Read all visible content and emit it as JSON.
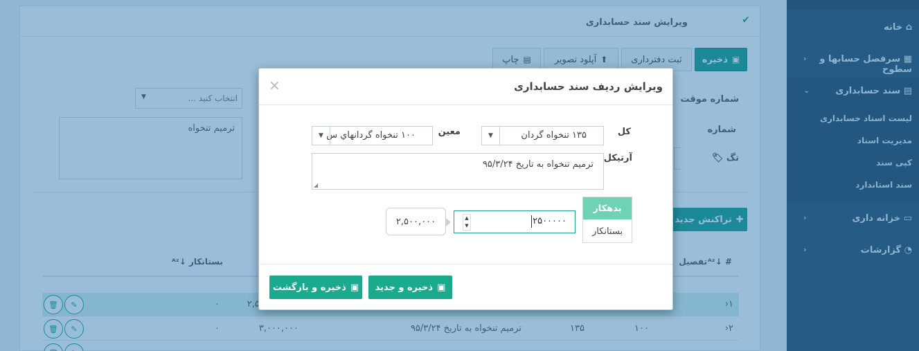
{
  "panel": {
    "title": "ویرایش سند حسابداری",
    "check_icon": "check-icon"
  },
  "toolbar": {
    "save": "ذخیره",
    "register": "ثبت دفترداری",
    "upload": "آپلود تصویر",
    "print": "چاپ"
  },
  "form": {
    "temp_number_label": "شماره موقت",
    "number_label": "شماره",
    "tag_label": "تگ",
    "select_placeholder": "انتخاب کنید ...",
    "description": "ترمیم تنخواه"
  },
  "new_transaction_button": "تراکنش جدید",
  "table": {
    "headers": {
      "index": "#",
      "detail": "تفصیل",
      "debit": "",
      "credit": "بستانکار"
    },
    "rows": [
      {
        "index": "۱",
        "debit": "۲,۵۰",
        "credit": "۰",
        "highlight": true
      },
      {
        "index": "۲",
        "moein": "۱۰۰",
        "kol": "۱۳۵",
        "article": "ترمیم تنخواه به تاریخ ۹۵/۳/۲۴",
        "debit": "۳,۰۰۰,۰۰۰",
        "credit": "۰",
        "highlight": false
      }
    ]
  },
  "sidebar": {
    "home": "خانه",
    "accounts": "سرفصل حسابها و سطوح",
    "voucher": "سند حسابداری",
    "voucher_sub": [
      "لیست اسناد حسابداری",
      "مدیریت اسناد",
      "کپی سند",
      "سند استاندارد"
    ],
    "treasury": "خزانه داری",
    "reports": "گزارشات"
  },
  "modal": {
    "title": "ویرایش ردیف سند حسابداری",
    "close": "×",
    "kol_label": "کل",
    "kol_value": "۱۳۵ تنخواه گردان",
    "moein_label": "معین",
    "moein_value": "۱۰۰ تنخواه گردانهاي س",
    "article_label": "آرتیکل",
    "article_value": "ترمیم تنخواه به تاریخ ۹۵/۳/۲۴",
    "debit_label": "بدهکار",
    "credit_label": "بستانکار",
    "amount_value": "۲۵۰۰۰۰۰",
    "amount_formatted": "۲,۵۰۰,۰۰۰",
    "save_new": "ذخیره و جدید",
    "save_back": "ذخیره و بازگشت"
  }
}
